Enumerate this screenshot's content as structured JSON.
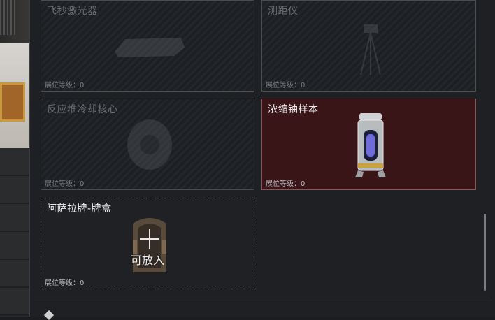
{
  "cards": [
    {
      "name": "飞秒激光器",
      "level_label": "展位等级：",
      "level": "0",
      "state": "dim"
    },
    {
      "name": "测距仪",
      "level_label": "展位等级：",
      "level": "0",
      "state": "dim"
    },
    {
      "name": "反应堆冷却核心",
      "level_label": "展位等级：",
      "level": "0",
      "state": "dim"
    },
    {
      "name": "浓缩铀样本",
      "level_label": "展位等级：",
      "level": "0",
      "state": "highlight"
    },
    {
      "name": "阿萨拉牌-牌盒",
      "level_label": "展位等级：",
      "level": "0",
      "state": "empty",
      "action": "可放入"
    }
  ],
  "colors": {
    "highlight": "#3a1518",
    "panel": "#1e2023"
  }
}
